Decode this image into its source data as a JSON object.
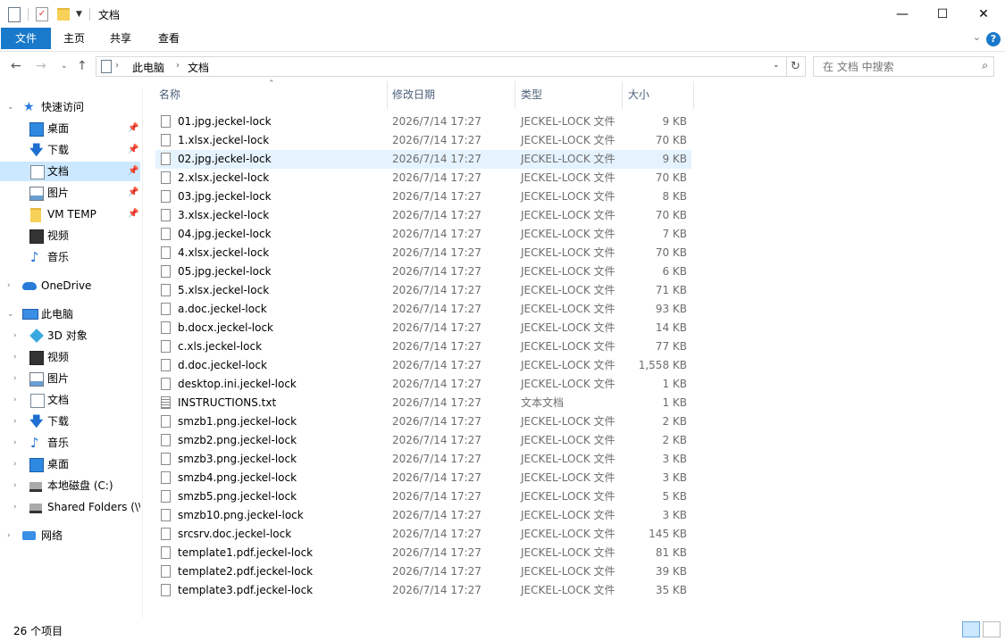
{
  "window": {
    "title": "文档",
    "controls": {
      "minimize": "—",
      "maximize": "☐",
      "close": "✕"
    }
  },
  "ribbon": {
    "tabs": [
      "文件",
      "主页",
      "共享",
      "查看"
    ],
    "help": "?"
  },
  "address": {
    "segments": [
      "此电脑",
      "文档"
    ],
    "search_placeholder": "在 文档 中搜索"
  },
  "nav": {
    "quick_access": {
      "label": "快速访问",
      "items": [
        {
          "label": "桌面",
          "icon": "desktop-icon",
          "pinned": true
        },
        {
          "label": "下载",
          "icon": "download-icon",
          "pinned": true
        },
        {
          "label": "文档",
          "icon": "document-icon",
          "pinned": true,
          "selected": true
        },
        {
          "label": "图片",
          "icon": "pictures-icon",
          "pinned": true
        },
        {
          "label": "VM TEMP",
          "icon": "folder-icon",
          "pinned": true
        },
        {
          "label": "视频",
          "icon": "video-icon",
          "pinned": false
        },
        {
          "label": "音乐",
          "icon": "music-icon",
          "pinned": false
        }
      ]
    },
    "onedrive": "OneDrive",
    "this_pc": {
      "label": "此电脑",
      "items": [
        {
          "label": "3D 对象",
          "icon": "3d-objects-icon"
        },
        {
          "label": "视频",
          "icon": "video-icon"
        },
        {
          "label": "图片",
          "icon": "pictures-icon"
        },
        {
          "label": "文档",
          "icon": "document-icon"
        },
        {
          "label": "下载",
          "icon": "download-icon"
        },
        {
          "label": "音乐",
          "icon": "music-icon"
        },
        {
          "label": "桌面",
          "icon": "desktop-icon"
        },
        {
          "label": "本地磁盘 (C:)",
          "icon": "drive-icon"
        },
        {
          "label": "Shared Folders (\\\\",
          "icon": "network-drive-icon"
        }
      ]
    },
    "network": "网络"
  },
  "columns": {
    "name": "名称",
    "date": "修改日期",
    "type": "类型",
    "size": "大小"
  },
  "files": [
    {
      "name": "01.jpg.jeckel-lock",
      "date": "2026/7/14 17:27",
      "type": "JECKEL-LOCK 文件",
      "size": "9 KB"
    },
    {
      "name": "1.xlsx.jeckel-lock",
      "date": "2026/7/14 17:27",
      "type": "JECKEL-LOCK 文件",
      "size": "70 KB"
    },
    {
      "name": "02.jpg.jeckel-lock",
      "date": "2026/7/14 17:27",
      "type": "JECKEL-LOCK 文件",
      "size": "9 KB"
    },
    {
      "name": "2.xlsx.jeckel-lock",
      "date": "2026/7/14 17:27",
      "type": "JECKEL-LOCK 文件",
      "size": "70 KB"
    },
    {
      "name": "03.jpg.jeckel-lock",
      "date": "2026/7/14 17:27",
      "type": "JECKEL-LOCK 文件",
      "size": "8 KB"
    },
    {
      "name": "3.xlsx.jeckel-lock",
      "date": "2026/7/14 17:27",
      "type": "JECKEL-LOCK 文件",
      "size": "70 KB"
    },
    {
      "name": "04.jpg.jeckel-lock",
      "date": "2026/7/14 17:27",
      "type": "JECKEL-LOCK 文件",
      "size": "7 KB"
    },
    {
      "name": "4.xlsx.jeckel-lock",
      "date": "2026/7/14 17:27",
      "type": "JECKEL-LOCK 文件",
      "size": "70 KB"
    },
    {
      "name": "05.jpg.jeckel-lock",
      "date": "2026/7/14 17:27",
      "type": "JECKEL-LOCK 文件",
      "size": "6 KB"
    },
    {
      "name": "5.xlsx.jeckel-lock",
      "date": "2026/7/14 17:27",
      "type": "JECKEL-LOCK 文件",
      "size": "71 KB"
    },
    {
      "name": "a.doc.jeckel-lock",
      "date": "2026/7/14 17:27",
      "type": "JECKEL-LOCK 文件",
      "size": "93 KB"
    },
    {
      "name": "b.docx.jeckel-lock",
      "date": "2026/7/14 17:27",
      "type": "JECKEL-LOCK 文件",
      "size": "14 KB"
    },
    {
      "name": "c.xls.jeckel-lock",
      "date": "2026/7/14 17:27",
      "type": "JECKEL-LOCK 文件",
      "size": "77 KB"
    },
    {
      "name": "d.doc.jeckel-lock",
      "date": "2026/7/14 17:27",
      "type": "JECKEL-LOCK 文件",
      "size": "1,558 KB"
    },
    {
      "name": "desktop.ini.jeckel-lock",
      "date": "2026/7/14 17:27",
      "type": "JECKEL-LOCK 文件",
      "size": "1 KB"
    },
    {
      "name": "INSTRUCTIONS.txt",
      "date": "2026/7/14 17:27",
      "type": "文本文档",
      "size": "1 KB"
    },
    {
      "name": "smzb1.png.jeckel-lock",
      "date": "2026/7/14 17:27",
      "type": "JECKEL-LOCK 文件",
      "size": "2 KB"
    },
    {
      "name": "smzb2.png.jeckel-lock",
      "date": "2026/7/14 17:27",
      "type": "JECKEL-LOCK 文件",
      "size": "2 KB"
    },
    {
      "name": "smzb3.png.jeckel-lock",
      "date": "2026/7/14 17:27",
      "type": "JECKEL-LOCK 文件",
      "size": "3 KB"
    },
    {
      "name": "smzb4.png.jeckel-lock",
      "date": "2026/7/14 17:27",
      "type": "JECKEL-LOCK 文件",
      "size": "3 KB"
    },
    {
      "name": "smzb5.png.jeckel-lock",
      "date": "2026/7/14 17:27",
      "type": "JECKEL-LOCK 文件",
      "size": "5 KB"
    },
    {
      "name": "smzb10.png.jeckel-lock",
      "date": "2026/7/14 17:27",
      "type": "JECKEL-LOCK 文件",
      "size": "3 KB"
    },
    {
      "name": "srcsrv.doc.jeckel-lock",
      "date": "2026/7/14 17:27",
      "type": "JECKEL-LOCK 文件",
      "size": "145 KB"
    },
    {
      "name": "template1.pdf.jeckel-lock",
      "date": "2026/7/14 17:27",
      "type": "JECKEL-LOCK 文件",
      "size": "81 KB"
    },
    {
      "name": "template2.pdf.jeckel-lock",
      "date": "2026/7/14 17:27",
      "type": "JECKEL-LOCK 文件",
      "size": "39 KB"
    },
    {
      "name": "template3.pdf.jeckel-lock",
      "date": "2026/7/14 17:27",
      "type": "JECKEL-LOCK 文件",
      "size": "35 KB"
    }
  ],
  "hover_row": 2,
  "status": {
    "count": "26 个项目"
  },
  "colors": {
    "accent": "#1979ca",
    "selection": "#cce8ff",
    "hover": "#e5f3ff"
  }
}
